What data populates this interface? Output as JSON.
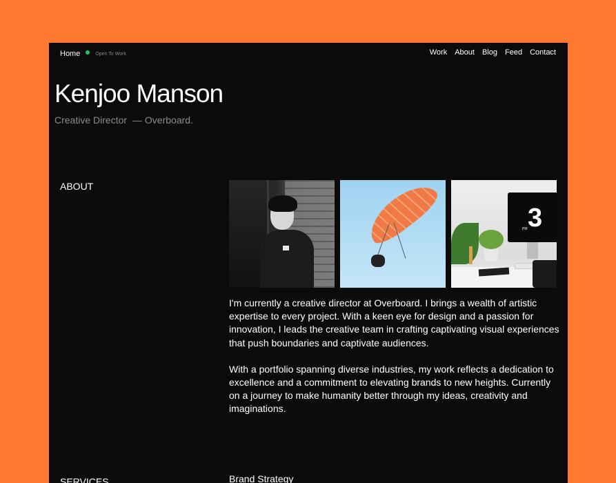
{
  "nav": {
    "home_label": "Home",
    "status_text": "Open To Work",
    "links": [
      "Work",
      "About",
      "Blog",
      "Feed",
      "Contact"
    ]
  },
  "hero": {
    "name": "Kenjoo Manson",
    "role": "Creative Director",
    "company": "— Overboard."
  },
  "about": {
    "label": "ABOUT",
    "paragraphs": [
      "I'm currently a creative director at Overboard. I brings a wealth of artistic expertise to every project. With a keen eye for design and a passion for innovation, I leads the creative team in crafting captivating visual experiences that push boundaries and captivate audiences.",
      "With a portfolio spanning diverse industries, my work reflects a dedication to excellence and a commitment to elevating brands to new heights. Currently on a journey to make humanity better through my ideas, creativity and imaginations."
    ],
    "photo_screen": {
      "pm": "PM",
      "number": "3"
    }
  },
  "services": {
    "label": "SERVICES",
    "first_item": "Brand Strategy"
  },
  "colors": {
    "background": "#FF7A30",
    "panel": "#0B0B0B",
    "status_dot": "#22C55E"
  }
}
